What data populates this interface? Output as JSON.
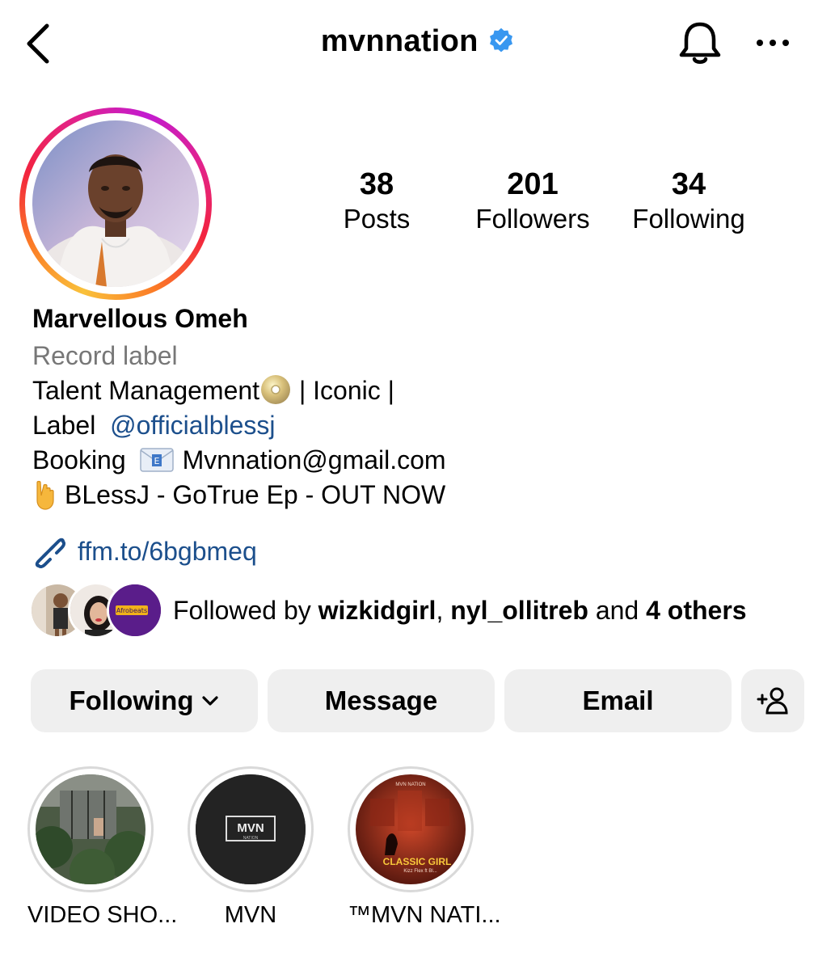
{
  "header": {
    "username": "mvnnation",
    "verified": true
  },
  "stats": {
    "posts": {
      "value": "38",
      "label": "Posts"
    },
    "followers": {
      "value": "201",
      "label": "Followers"
    },
    "following": {
      "value": "34",
      "label": "Following"
    }
  },
  "profile": {
    "full_name": "Marvellous Omeh",
    "category": "Record label",
    "bio_line1_text": "Talent Management",
    "bio_line1_suffix": " | Iconic |",
    "bio_line2_prefix": "Label  ",
    "bio_line2_mention": "@officialblessj",
    "bio_line3_prefix": "Booking",
    "bio_line3_email": "Mvnnation@gmail.com",
    "bio_line4_text": "BLessJ  - GoTrue Ep - OUT NOW",
    "link": "ffm.to/6bgbmeq"
  },
  "followed_by": {
    "prefix": "Followed by ",
    "user1": "wizkidgirl",
    "separator": ", ",
    "user2": "nyl_ollitreb",
    "middle": " and ",
    "others": "4 others",
    "avatar3_text": "Afrobeats"
  },
  "actions": {
    "following": "Following",
    "message": "Message",
    "email": "Email"
  },
  "highlights": [
    {
      "label": "VIDEO SHO..."
    },
    {
      "label": "MVN",
      "cover_text": "MVN",
      "cover_subtext": "NATION"
    },
    {
      "label": "™MVN NATI...",
      "cover_top": "MVN NATION",
      "cover_title": "CLASSIC GIRL",
      "cover_sub": "Kizz Flex ft Bl..."
    }
  ],
  "colors": {
    "link": "#1c4f8c",
    "verified": "#3897f0",
    "button_bg": "#efefef",
    "muted": "#777777"
  },
  "icons": [
    "chevron-left-icon",
    "verified-badge-icon",
    "bell-icon",
    "more-icon",
    "link-icon",
    "chevron-down-icon",
    "add-person-icon",
    "cd-emoji",
    "envelope-emoji",
    "pointing-down-emoji"
  ]
}
